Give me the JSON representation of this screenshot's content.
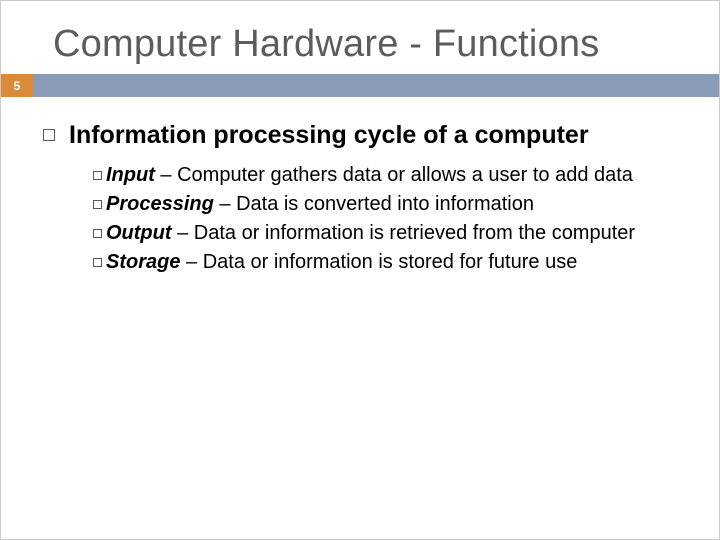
{
  "title": "Computer Hardware - Functions",
  "pageNumber": "5",
  "heading": "Information processing cycle of a computer",
  "bullets": [
    {
      "term": "Input",
      "desc": " – Computer gathers data or allows a user to add data"
    },
    {
      "term": "Processing",
      "desc": " – Data is converted into information"
    },
    {
      "term": "Output",
      "desc": " – Data or information is retrieved from the computer"
    },
    {
      "term": "Storage",
      "desc": " – Data or information is stored for future use"
    }
  ]
}
